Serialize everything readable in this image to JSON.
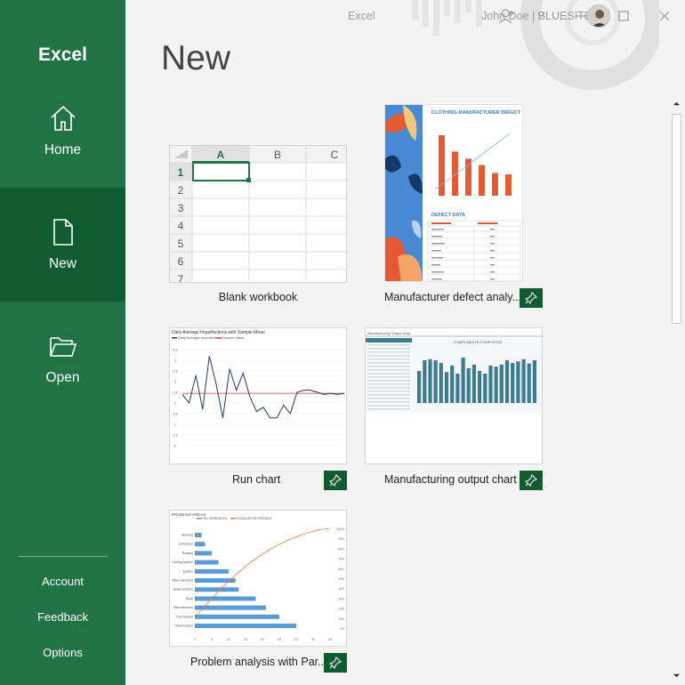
{
  "sidebar": {
    "app_name": "Excel",
    "nav": [
      {
        "label": "Home",
        "icon": "home-icon"
      },
      {
        "label": "New",
        "icon": "new-document-icon",
        "active": true
      },
      {
        "label": "Open",
        "icon": "folder-open-icon"
      }
    ],
    "bottom_links": [
      "Account",
      "Feedback",
      "Options"
    ]
  },
  "titlebar": {
    "window_title": "Excel",
    "user_name": "John Doe | BLUESITE",
    "icons": [
      "people-icon",
      "help-icon",
      "minimize-icon",
      "restore-icon",
      "close-icon"
    ]
  },
  "page": {
    "title": "New"
  },
  "templates": [
    {
      "label": "Blank workbook",
      "pinnable": false
    },
    {
      "label": "Manufacturer defect analy...",
      "pinnable": true
    },
    {
      "label": "Run chart",
      "pinnable": true
    },
    {
      "label": "Manufacturing output chart",
      "pinnable": true
    },
    {
      "label": "Problem analysis with Par...",
      "pinnable": true
    }
  ],
  "blank_grid": {
    "columns": [
      "A",
      "B",
      "C"
    ],
    "rows": [
      "1",
      "2",
      "3",
      "4",
      "5",
      "6",
      "7"
    ]
  },
  "thumbs": {
    "defect": {
      "header": "CLOTHING MANUFACTURER DEFECT",
      "section": "DEFECT DATA",
      "bars": [
        0.85,
        0.62,
        0.52,
        0.43,
        0.32,
        0.3
      ]
    },
    "run_chart": {
      "title": "Daily Average Imperfections with Sample Mean",
      "legend": [
        "Daily Average Imperfections",
        "Sample Mean"
      ],
      "y_ticks": [
        "4.5",
        "4",
        "3.5",
        "3",
        "2.5",
        "2",
        "1.5",
        "1",
        "0.5",
        "0"
      ],
      "values": [
        2.4,
        2.0,
        3.3,
        1.7,
        4.2,
        2.9,
        1.3,
        3.6,
        2.6,
        3.4,
        2.3,
        1.6,
        1.8,
        1.3,
        1.3,
        1.9,
        1.5,
        2.5,
        2.6,
        2.6,
        2.5,
        2.4,
        2.45,
        2.4,
        2.45
      ],
      "mean": 2.45,
      "colors": {
        "series": "#203a66",
        "mean": "#e0584e"
      }
    },
    "output_chart": {
      "tab": "Manufacturing Output Data",
      "title": "COMPONENTS COMPLETED",
      "bars": [
        0.6,
        0.8,
        0.82,
        0.8,
        0.75,
        0.58,
        0.7,
        0.55,
        0.85,
        0.65,
        0.72,
        0.6,
        0.55,
        0.7,
        0.68,
        0.72,
        0.8,
        0.75,
        0.78,
        0.82,
        0.74,
        0.8
      ],
      "color": "#3d7b8f"
    },
    "problem_chart": {
      "title": "PROBLEM AREAS",
      "legend": [
        "OCCURRENCES",
        "CUMULATIVE PERCENT"
      ],
      "categories": [
        "Steering",
        "Emissions",
        "Braking",
        "Cooling system",
        "Ignition",
        "Other electrical",
        "Brake controls",
        "Body",
        "Miscellaneous",
        "Fuel system",
        "Transmission"
      ],
      "values": [
        2,
        3,
        5,
        7,
        10,
        12,
        13,
        18,
        21,
        25,
        30
      ],
      "x_ticks": [
        "0",
        "5",
        "10",
        "15",
        "20",
        "25",
        "30",
        "35",
        "40"
      ],
      "right_ticks": [
        "100%",
        "90%",
        "80%",
        "70%",
        "60%",
        "50%",
        "40%",
        "30%",
        "20%",
        "10%",
        "0%"
      ],
      "colors": {
        "bars": "#5b9bd5",
        "line": "#ed7d31"
      }
    }
  },
  "colors": {
    "sidebar": "#217346",
    "sidebar_active": "#0e5c2f",
    "accent_pin": "#0e5c2f"
  }
}
